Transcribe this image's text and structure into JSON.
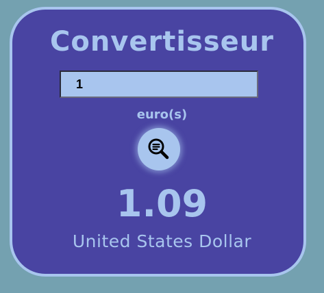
{
  "converter": {
    "title": "Convertisseur",
    "amount_value": "1",
    "source_currency_label": "euro(s)",
    "result_value": "1.09",
    "result_currency": "United States Dollar"
  },
  "icons": {
    "convert_button_icon": "search-icon"
  },
  "colors": {
    "background": "#74a1b0",
    "card": "#4944a2",
    "accent": "#a8c5ee",
    "icon": "#000000"
  }
}
